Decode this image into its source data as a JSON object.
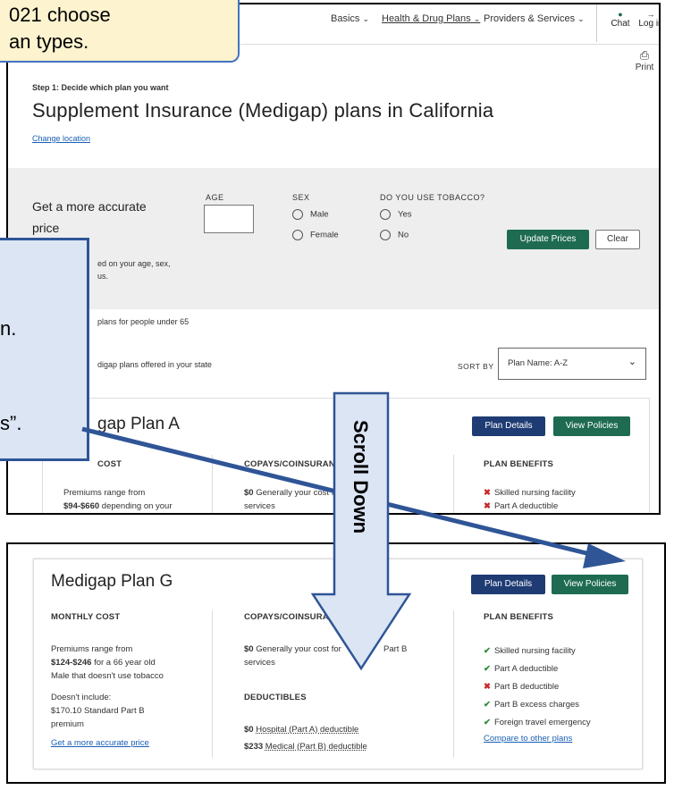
{
  "callout_top": {
    "line1": "021 choose",
    "line2": "an types."
  },
  "callout_left": {
    "line1": "n.",
    "line2": "s”."
  },
  "scroll_label": "Scroll Down",
  "nav": {
    "basics": "Basics",
    "health": "Health & Drug Plans",
    "providers": "Providers & Services",
    "chat": "Chat",
    "login": "Log in",
    "print": "Print"
  },
  "header": {
    "step": "Step 1: Decide which plan you want",
    "title": "Supplement Insurance (Medigap) plans in California",
    "change_location": "Change location"
  },
  "pricing": {
    "heading_line1": "Get a more accurate",
    "heading_line2": "price",
    "age_label": "AGE",
    "sex_label": "SEX",
    "sex_options": [
      "Male",
      "Female"
    ],
    "tobacco_label": "DO YOU USE TOBACCO?",
    "tobacco_options": [
      "Yes",
      "No"
    ],
    "update_btn": "Update Prices",
    "clear_btn": "Clear",
    "note_line1": "ed on your age, sex,",
    "note_line2": "us."
  },
  "filters": {
    "under65": "plans for people under 65",
    "offered": "digap plans offered in your state",
    "sort_label": "SORT BY",
    "sort_value": "Plan Name: A-Z"
  },
  "plan_a": {
    "title": "gap Plan A",
    "details_btn": "Plan Details",
    "policies_btn": "View Policies",
    "col1_head": "COST",
    "col2_head": "COPAYS/COINSURAN",
    "col3_head": "PLAN BENEFITS",
    "premium_line1": "Premiums range from",
    "premium_amount": "$94-$660",
    "premium_rest": " depending on your",
    "copay_amount": "$0",
    "copay_text": " Generally your cost f",
    "copay_tail": "t B",
    "copay_line2": "services",
    "benefits": [
      "Skilled nursing facility",
      "Part A deductible"
    ]
  },
  "plan_g": {
    "title": "Medigap Plan G",
    "details_btn": "Plan Details",
    "policies_btn": "View Policies",
    "col1_head": "MONTHLY COST",
    "col2_head": "COPAYS/COINSURA",
    "col3_head": "PLAN BENEFITS",
    "premium_line1": "Premiums range from",
    "premium_amount": "$124-$246",
    "premium_rest": " for a 66 year old",
    "premium_line3": "Male that doesn't use tobacco",
    "doesnt_include": "Doesn't include:",
    "part_b_line1": "$170.10 Standard Part B",
    "part_b_line2": "premium",
    "accurate_link": "Get a more accurate price",
    "copay_amount": "$0",
    "copay_text": " Generally your cost for",
    "copay_tail": "Part B",
    "copay_line2": "services",
    "deductibles_head": "DEDUCTIBLES",
    "ded1_amount": "$0",
    "ded1_text": "Hospital (Part A) deductible",
    "ded2_amount": "$233",
    "ded2_text": "Medical (Part B) deductible",
    "benefits": [
      {
        "text": "Skilled nursing facility",
        "status": "yes"
      },
      {
        "text": "Part A deductible",
        "status": "yes"
      },
      {
        "text": "Part B deductible",
        "status": "no"
      },
      {
        "text": "Part B excess charges",
        "status": "yes"
      },
      {
        "text": "Foreign travel emergency",
        "status": "yes"
      }
    ],
    "compare_link": "Compare to other plans"
  },
  "colors": {
    "green": "#1e6b52",
    "navy": "#1f3b73",
    "arrow": "#2f5597",
    "callout_blue": "#dbe5f4",
    "callout_yellow": "#fdf3cf"
  }
}
